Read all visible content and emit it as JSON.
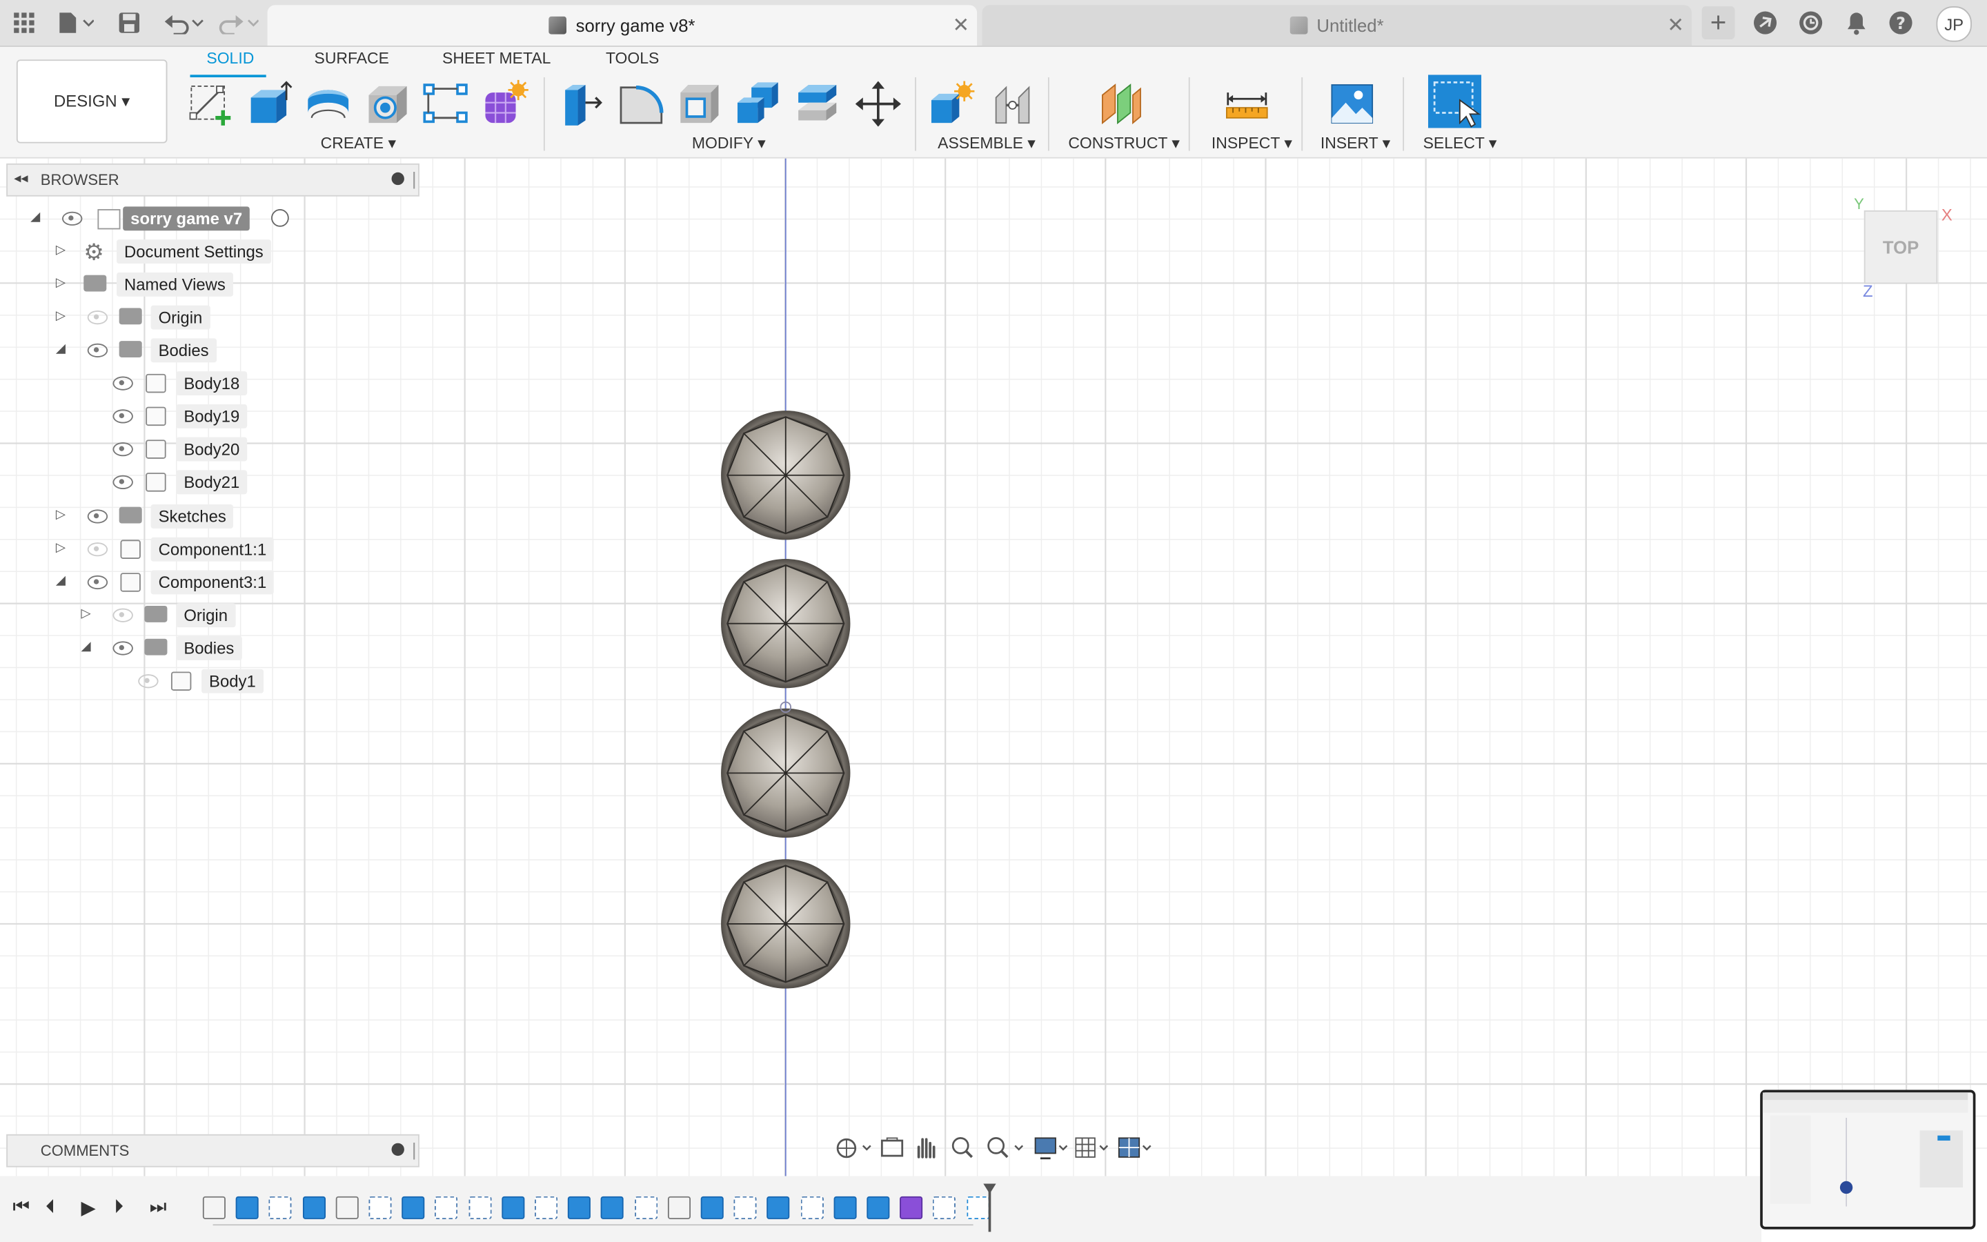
{
  "tabs": {
    "active": "sorry game v8*",
    "inactive": "Untitled*",
    "close_icon": "✕",
    "new_tab_icon": "+"
  },
  "user": {
    "initials": "JP"
  },
  "workspace": {
    "label": "DESIGN ▾"
  },
  "mode_tabs": [
    "SOLID",
    "SURFACE",
    "SHEET METAL",
    "TOOLS"
  ],
  "tool_groups": {
    "create": "CREATE ▾",
    "modify": "MODIFY ▾",
    "assemble": "ASSEMBLE ▾",
    "construct": "CONSTRUCT ▾",
    "inspect": "INSPECT ▾",
    "insert": "INSERT ▾",
    "select": "SELECT ▾"
  },
  "browser": {
    "title": "BROWSER",
    "root": "sorry game v7",
    "items": {
      "document_settings": "Document Settings",
      "named_views": "Named Views",
      "origin": "Origin",
      "bodies": "Bodies",
      "body18": "Body18",
      "body19": "Body19",
      "body20": "Body20",
      "body21": "Body21",
      "sketches": "Sketches",
      "component1": "Component1:1",
      "component3": "Component3:1",
      "c3_origin": "Origin",
      "c3_bodies": "Bodies",
      "body1": "Body1"
    }
  },
  "comments": {
    "title": "COMMENTS"
  },
  "viewcube": {
    "face": "TOP",
    "axis_x": "X",
    "axis_y": "Y",
    "axis_z": "Z"
  },
  "colors": {
    "accent": "#0696d7",
    "body_grey": "#8c877f",
    "grid": "#dcdcdc"
  }
}
